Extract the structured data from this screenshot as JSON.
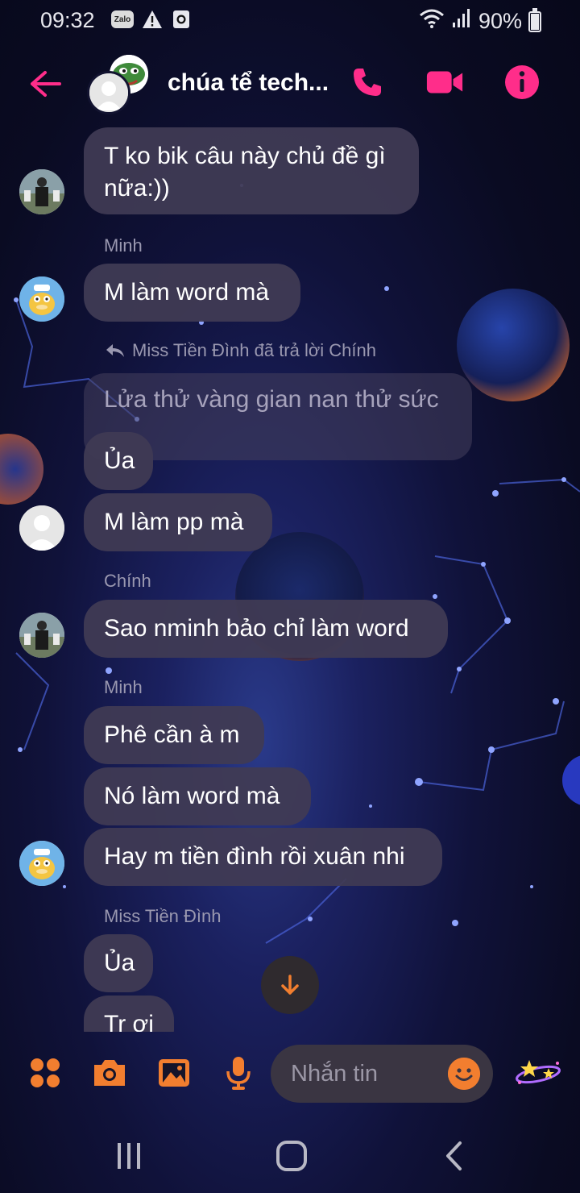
{
  "status_bar": {
    "time": "09:32",
    "zalo_label": "Zalo",
    "battery": "90%",
    "battery_level": 0.9,
    "icons": [
      "zalo-icon",
      "warning-icon",
      "screen-record-icon",
      "wifi-icon",
      "signal-icon",
      "battery-icon"
    ]
  },
  "header": {
    "title": "chúa tể tech...",
    "icons": [
      "back-arrow-icon",
      "phone-icon",
      "video-camera-icon",
      "info-icon"
    ],
    "accent": "#ff2d8a"
  },
  "messages": {
    "m1": "T ko bik câu này chủ đề gì nữa:))",
    "s1": "Minh",
    "m2": "M làm word mà",
    "reply_note": "Miss Tiền Đình đã trả lời Chính",
    "quoted": "Lửa thử vàng gian nan thử sức",
    "m3": "Ủa",
    "m4": "M làm pp mà",
    "s2": "Chính",
    "m5": "Sao nminh bảo chỉ làm word",
    "s3": "Minh",
    "m6": "Phê cần à m",
    "m7": "Nó làm word mà",
    "m8": "Hay m tiền đình rồi xuân nhi",
    "s4": "Miss Tiền Đình",
    "m9": "Ủa",
    "m10": "Tr ơi"
  },
  "composer": {
    "placeholder": "Nhắn tin",
    "icons": [
      "apps-grid-icon",
      "camera-icon",
      "image-icon",
      "microphone-icon",
      "emoji-icon",
      "galaxy-stars-sticker-icon"
    ],
    "accent": "#f27e2f"
  },
  "nav_bar": {
    "icons": [
      "recent-apps-icon",
      "home-icon",
      "back-icon"
    ]
  }
}
